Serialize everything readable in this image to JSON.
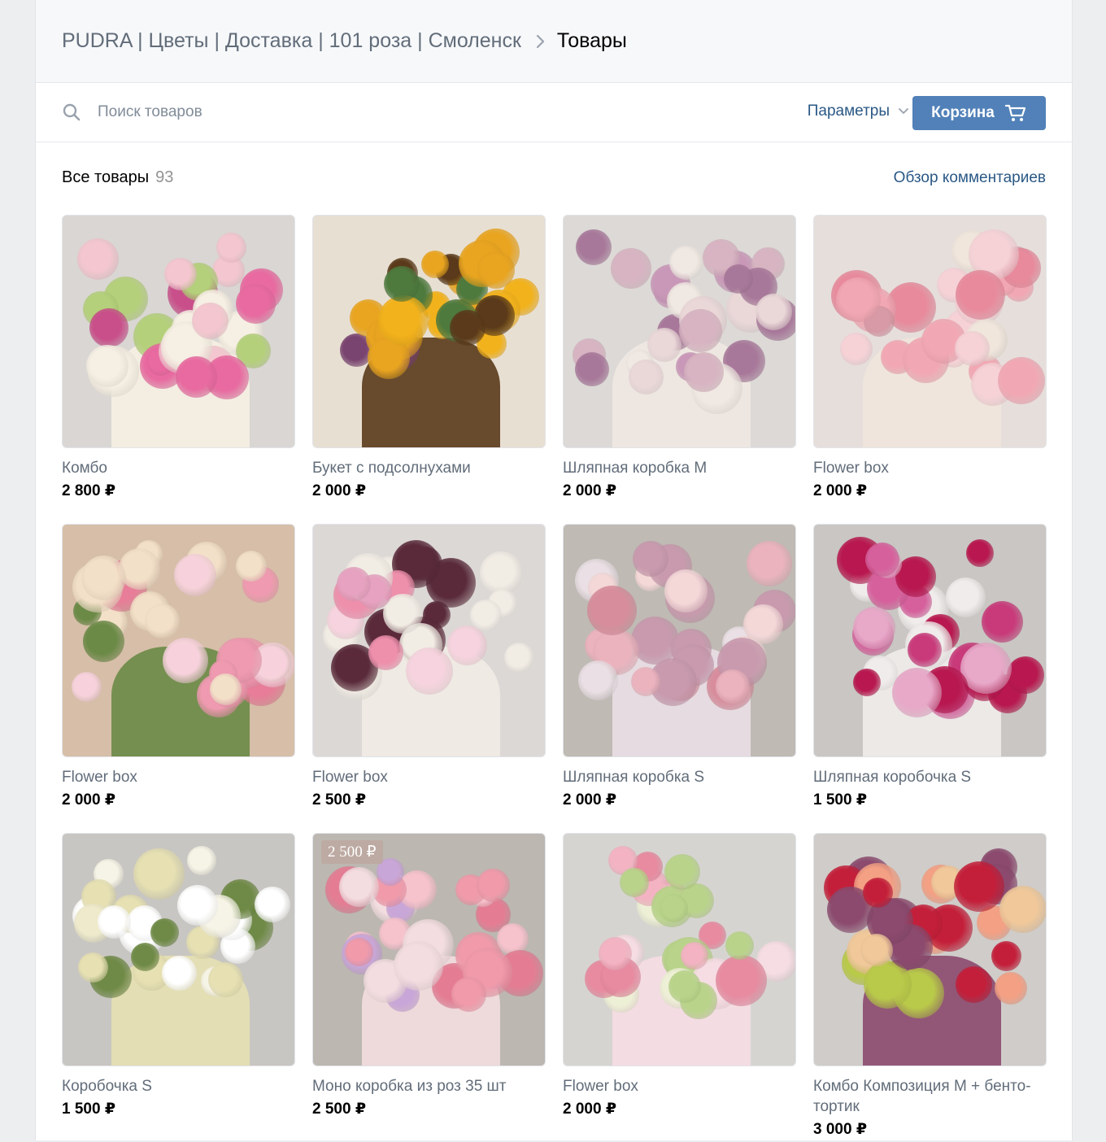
{
  "breadcrumb": {
    "group": "PUDRA | Цветы | Доставка | 101 роза | Смоленск",
    "current": "Товары"
  },
  "toolbar": {
    "search_placeholder": "Поиск товаров",
    "params_label": "Параметры",
    "cart_label": "Корзина"
  },
  "section": {
    "title": "Все товары",
    "count": "93",
    "review_link": "Обзор комментариев"
  },
  "products": [
    {
      "name": "Комбо",
      "price": "2 800 ₽",
      "colors": [
        "#e86aa0",
        "#f4c6cf",
        "#c94f8a",
        "#f6efe3",
        "#b4d07a"
      ],
      "bg": "#d9d6d3"
    },
    {
      "name": "Букет с подсолнухами",
      "price": "2 000 ₽",
      "colors": [
        "#f2b21c",
        "#7a4470",
        "#e9a520",
        "#5a3a1a",
        "#4e7a3e"
      ],
      "bg": "#e8dfd3"
    },
    {
      "name": "Шляпная коробка M",
      "price": "2 000 ₽",
      "colors": [
        "#c998b8",
        "#ead7d8",
        "#a8789a",
        "#f0e8e2",
        "#d8b4c2"
      ],
      "bg": "#dcd9d6"
    },
    {
      "name": "Flower box",
      "price": "2 000 ₽",
      "colors": [
        "#f2a8b4",
        "#f6d2d7",
        "#e88a9c",
        "#f0e6dc",
        "#d79aa6"
      ],
      "bg": "#e6dedb"
    },
    {
      "name": "Flower box",
      "price": "2 000 ₽",
      "colors": [
        "#ef9ab0",
        "#f7d2dc",
        "#e77d98",
        "#6a8a46",
        "#f3e0c8"
      ],
      "bg": "#d6bea8"
    },
    {
      "name": "Flower box",
      "price": "2 500 ₽",
      "colors": [
        "#ee8fac",
        "#f6d3de",
        "#e6a2c0",
        "#f1ece4",
        "#5a2a3a"
      ],
      "bg": "#dcd8d6"
    },
    {
      "name": "Шляпная коробка S",
      "price": "2 000 ₽",
      "colors": [
        "#ebb3be",
        "#f4d8d8",
        "#c99aae",
        "#e9dfe4",
        "#d88d9c"
      ],
      "bg": "#bfbab4"
    },
    {
      "name": "Шляпная коробочка S",
      "price": "1 500 ₽",
      "colors": [
        "#b8184f",
        "#d6609c",
        "#e8a8c8",
        "#f0eceb",
        "#c83a7a"
      ],
      "bg": "#c9c6c3"
    },
    {
      "name": "Коробочка S",
      "price": "1 500 ₽",
      "colors": [
        "#f6f4e6",
        "#eeeacb",
        "#ffffff",
        "#e6e0b2",
        "#6f8a46"
      ],
      "bg": "#c8c6c2"
    },
    {
      "name": "Моно коробка из роз 35 шт",
      "price": "2 500 ₽",
      "colors": [
        "#f09aaa",
        "#f6c2cc",
        "#e47d94",
        "#f3dde0",
        "#c9a6d8"
      ],
      "bg": "#bcb7b1",
      "badge": "2 500 ₽"
    },
    {
      "name": "Flower box",
      "price": "2 000 ₽",
      "colors": [
        "#f3b3c2",
        "#eef0d6",
        "#e88aa0",
        "#f6dde3",
        "#b9d48a"
      ],
      "bg": "#d6d4d1"
    },
    {
      "name": "Комбо Композиция M + бенто-тортик",
      "price": "3 000 ₽",
      "colors": [
        "#c41f3a",
        "#f3a084",
        "#f0c89a",
        "#8b4a6e",
        "#b9c94a"
      ],
      "bg": "#cfccc9"
    }
  ]
}
